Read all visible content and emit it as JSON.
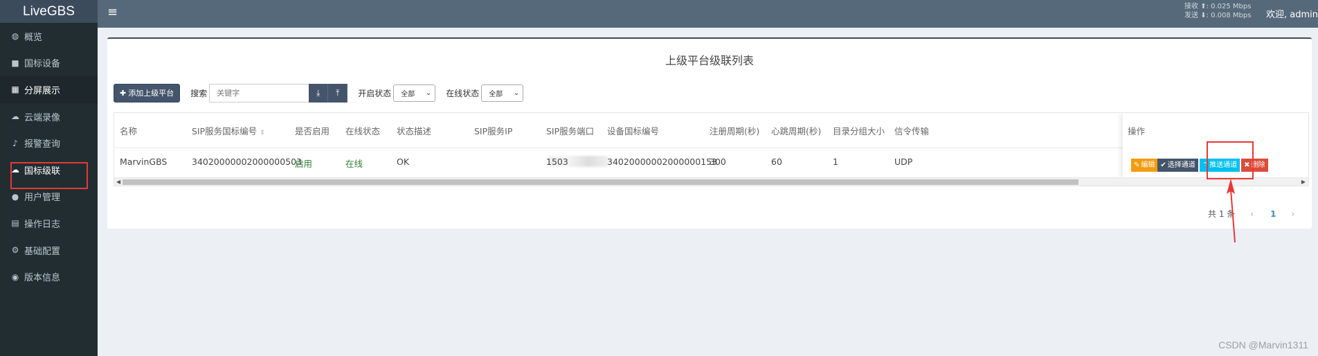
{
  "app": {
    "title": "LiveGBS"
  },
  "sidebar": {
    "items": [
      {
        "label": "概览",
        "icon": "dashboard-icon"
      },
      {
        "label": "国标设备",
        "icon": "video-camera-icon"
      },
      {
        "label": "分屏展示",
        "icon": "grid-icon"
      },
      {
        "label": "云端录像",
        "icon": "cloud-icon"
      },
      {
        "label": "报警查询",
        "icon": "bell-icon"
      },
      {
        "label": "国标级联",
        "icon": "cloud-upload-icon"
      },
      {
        "label": "用户管理",
        "icon": "users-icon"
      },
      {
        "label": "操作日志",
        "icon": "file-icon"
      },
      {
        "label": "基础配置",
        "icon": "gears-icon"
      },
      {
        "label": "版本信息",
        "icon": "globe-icon"
      }
    ]
  },
  "header": {
    "menu_icon": "≡",
    "net": {
      "rx_label": "接收",
      "rx_value": ": 0.025 Mbps",
      "tx_label": "发送",
      "tx_value": ": 0.008 Mbps"
    },
    "welcome": "欢迎, admin"
  },
  "main": {
    "title": "上级平台级联列表",
    "toolbar": {
      "add_button": "添加上级平台",
      "search_label": "搜索",
      "search_placeholder": "关键字",
      "enabled_label": "开启状态",
      "enabled_value": "全部",
      "online_label": "在线状态",
      "online_value": "全部"
    },
    "table": {
      "headers": [
        "名称",
        "SIP服务国标编号",
        "是否启用",
        "在线状态",
        "状态描述",
        "SIP服务IP",
        "SIP服务端口",
        "设备国标编号",
        "注册周期(秒)",
        "心跳周期(秒)",
        "目录分组大小",
        "信令传输",
        "操作"
      ],
      "rows": [
        {
          "name": "MarvinGBS",
          "sip_id": "34020000002000000503",
          "enabled": "启用",
          "online": "在线",
          "status": "OK",
          "sip_ip": "",
          "sip_port": "1503",
          "device_id": "34020000002000000153",
          "register_period": "300",
          "heartbeat_period": "60",
          "catalog_size": "1",
          "transport": "UDP"
        }
      ],
      "actions": {
        "edit": "编辑",
        "select_channel": "选择通道",
        "push_channel": "推送通道",
        "delete": "删除"
      }
    },
    "pagination": {
      "total": "共 1 条",
      "current": "1"
    }
  },
  "watermark": "CSDN @Marvin1311",
  "colors": {
    "sidebar_bg": "#222d32",
    "header_bg": "#55697a",
    "edit": "#f39c12",
    "push": "#00c0ef",
    "delete": "#dd4b39",
    "annotation": "#e53935"
  }
}
